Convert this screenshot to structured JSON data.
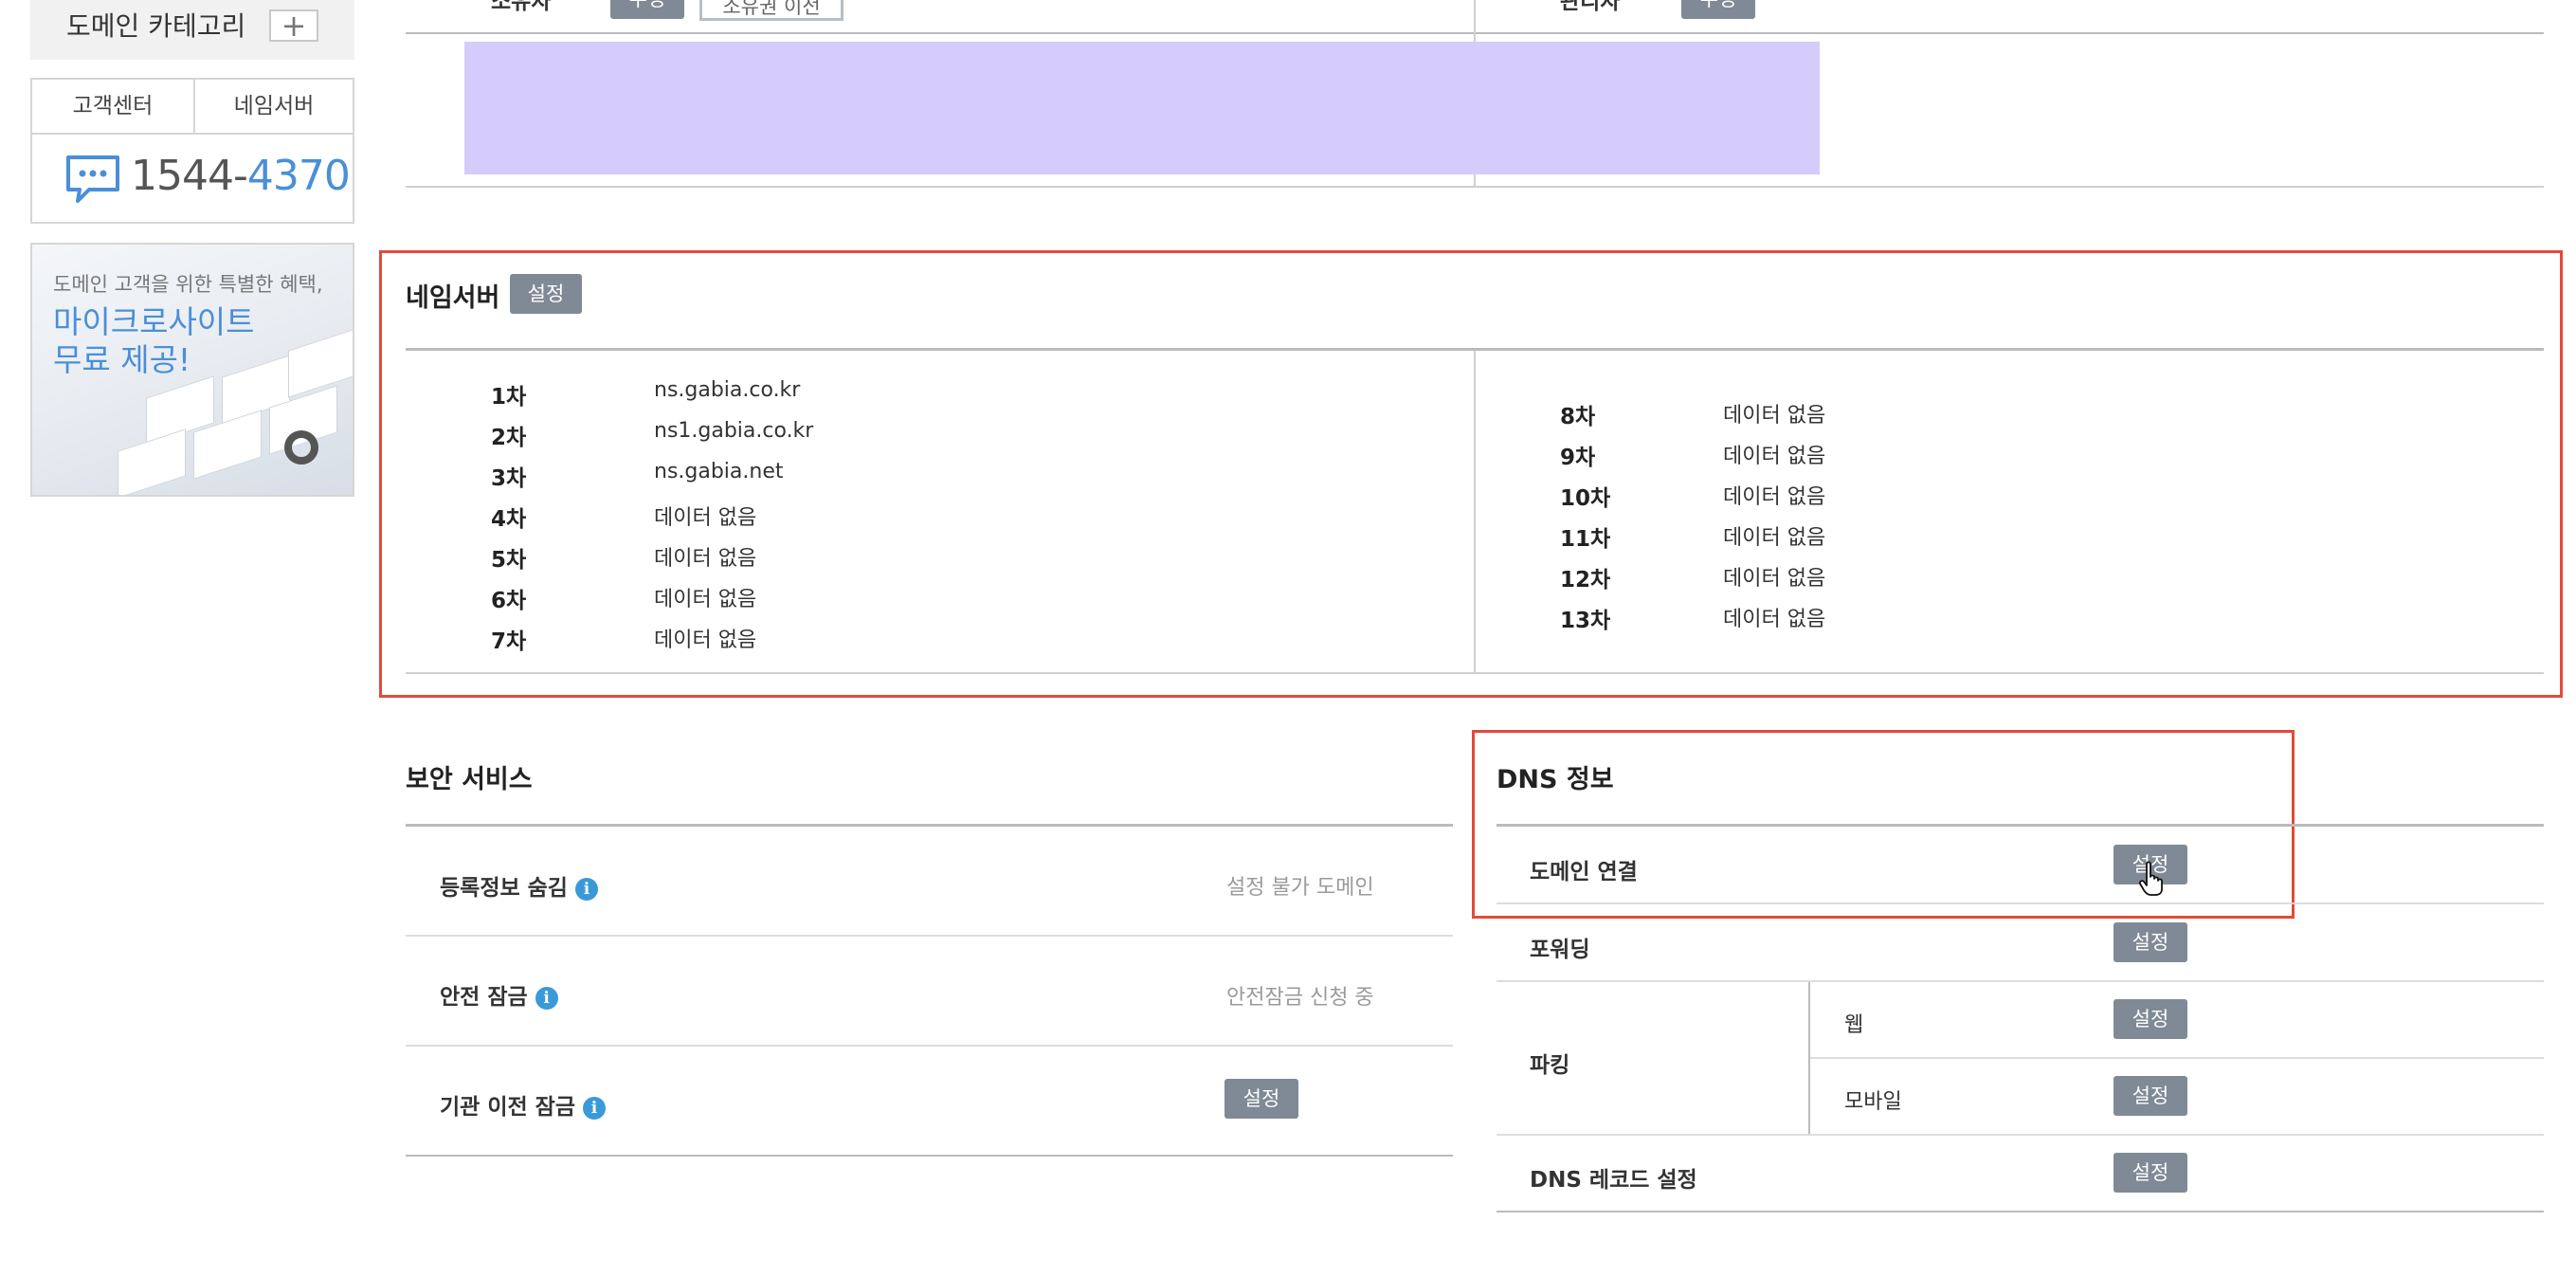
{
  "sidebar": {
    "category_label": "도메인 카테고리",
    "add_icon": "plus-icon",
    "support_tabs": [
      "고객센터",
      "네임서버"
    ],
    "chat_icon": "chat-bubble-icon",
    "phone_prefix": "1544-",
    "phone_suffix": "4370",
    "promo_subtitle": "도메인 고객을 위한 특별한 혜택,",
    "promo_title_line1": "마이크로사이트",
    "promo_title_line2": "무료 제공!"
  },
  "top_partial": {
    "left_label": "소유자",
    "left_edit": "수정",
    "left_transfer": "소유권 이전",
    "right_label": "관리자",
    "right_edit": "수정",
    "highlight_color": "#d5ccfb"
  },
  "nameserver": {
    "title": "네임서버",
    "setting_button": "설정",
    "left": [
      {
        "rank": "1차",
        "value": "ns.gabia.co.kr"
      },
      {
        "rank": "2차",
        "value": "ns1.gabia.co.kr"
      },
      {
        "rank": "3차",
        "value": "ns.gabia.net"
      },
      {
        "rank": "4차",
        "value": "데이터 없음"
      },
      {
        "rank": "5차",
        "value": "데이터 없음"
      },
      {
        "rank": "6차",
        "value": "데이터 없음"
      },
      {
        "rank": "7차",
        "value": "데이터 없음"
      }
    ],
    "right": [
      {
        "rank": "8차",
        "value": "데이터 없음"
      },
      {
        "rank": "9차",
        "value": "데이터 없음"
      },
      {
        "rank": "10차",
        "value": "데이터 없음"
      },
      {
        "rank": "11차",
        "value": "데이터 없음"
      },
      {
        "rank": "12차",
        "value": "데이터 없음"
      },
      {
        "rank": "13차",
        "value": "데이터 없음"
      }
    ]
  },
  "security": {
    "title": "보안 서비스",
    "rows": [
      {
        "label": "등록정보 숨김",
        "value": "설정 불가 도메인"
      },
      {
        "label": "안전 잠금",
        "value": "안전잠금 신청 중"
      },
      {
        "label": "기관 이전 잠금",
        "button": "설정"
      }
    ]
  },
  "dns": {
    "title": "DNS 정보",
    "domain_link": {
      "label": "도메인 연결",
      "button": "설정"
    },
    "forwarding": {
      "label": "포워딩",
      "button": "설정"
    },
    "parking": {
      "label": "파킹",
      "web": "웹",
      "web_button": "설정",
      "mobile": "모바일",
      "mobile_button": "설정"
    },
    "records": {
      "label": "DNS 레코드 설정",
      "button": "설정"
    }
  },
  "colors": {
    "highlight_border": "#e34a3a",
    "button_bg": "#808a96",
    "accent_blue": "#4a8fd8"
  }
}
